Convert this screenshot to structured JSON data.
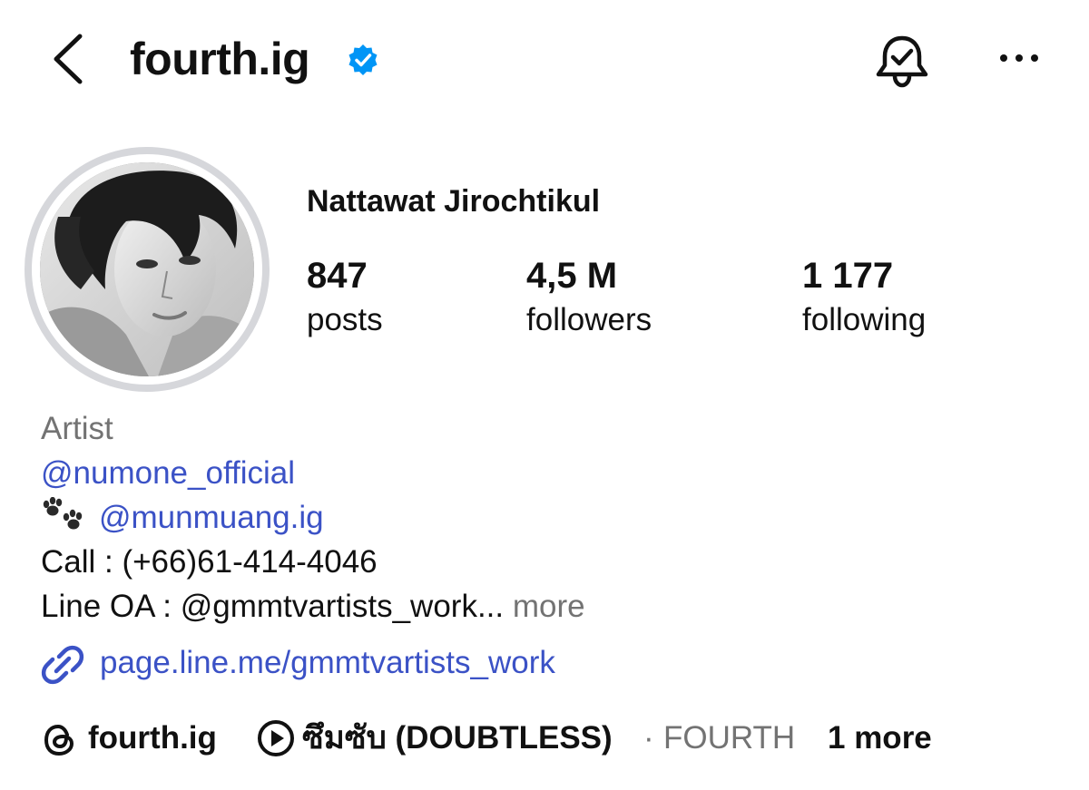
{
  "header": {
    "username": "fourth.ig",
    "verified": true,
    "icons": [
      "back-chevron-icon",
      "verified-badge-icon",
      "notification-bell-icon",
      "more-options-icon"
    ]
  },
  "profile": {
    "full_name": "Nattawat Jirochtikul",
    "stats": [
      {
        "value": "847",
        "label": "posts"
      },
      {
        "value": "4,5 M",
        "label": "followers"
      },
      {
        "value": "1 177",
        "label": "following"
      }
    ]
  },
  "bio": {
    "category": "Artist",
    "mention_1": "@numone_official",
    "paw_emoji": "🐾",
    "mention_2": "@munmuang.ig",
    "call_line": "Call : (+66)61-414-4046",
    "line_oa": "Line OA : @gmmtvartists_work...",
    "more_label": "more"
  },
  "link": {
    "text": "page.line.me/gmmtvartists_work"
  },
  "bottom": {
    "threads_handle": "fourth.ig",
    "song_title": "ซึมซับ (DOUBTLESS)",
    "separator": "·",
    "song_artist": "FOURTH",
    "more_label": "1 more"
  },
  "colors": {
    "link_blue": "#3b52c6",
    "verified_blue": "#0095f6",
    "secondary_grey": "#737373",
    "avatar_ring": "#d6d7db"
  }
}
